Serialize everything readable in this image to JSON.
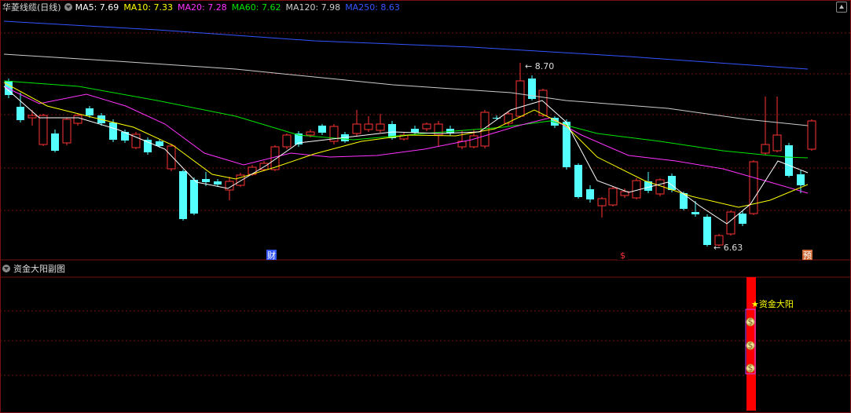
{
  "main": {
    "title": "华菱线缆(日线)",
    "ma": [
      {
        "label": "MA5: 7.69",
        "color": "#ffffff"
      },
      {
        "label": "MA10: 7.33",
        "color": "#ffff00"
      },
      {
        "label": "MA20: 7.28",
        "color": "#ff33ff"
      },
      {
        "label": "MA60: 7.62",
        "color": "#00e600"
      },
      {
        "label": "MA120: 7.98",
        "color": "#cccccc"
      },
      {
        "label": "MA250: 8.63",
        "color": "#3355ff"
      }
    ],
    "high_label": "8.70",
    "low_label": "6.63",
    "markers": [
      "财",
      "$",
      "预"
    ],
    "colors": {
      "up": "#ff3333",
      "down": "#54ffff",
      "grid": "#7a1010"
    }
  },
  "sub": {
    "title": "资金大阳副图",
    "signal_label": "资金大阳",
    "signal_color": "#ff0000",
    "label_color": "#ffff00"
  },
  "chart_data": {
    "type": "candlestick",
    "series": [
      {
        "name": "MA5",
        "values": []
      },
      {
        "name": "MA10",
        "values": []
      },
      {
        "name": "MA20",
        "values": []
      },
      {
        "name": "MA60",
        "values": []
      },
      {
        "name": "MA120",
        "values": []
      },
      {
        "name": "MA250",
        "values": []
      }
    ],
    "high": 8.7,
    "low": 6.63,
    "last": {
      "MA5": 7.69,
      "MA10": 7.33,
      "MA20": 7.28,
      "MA60": 7.62,
      "MA120": 7.98,
      "MA250": 8.63
    }
  }
}
